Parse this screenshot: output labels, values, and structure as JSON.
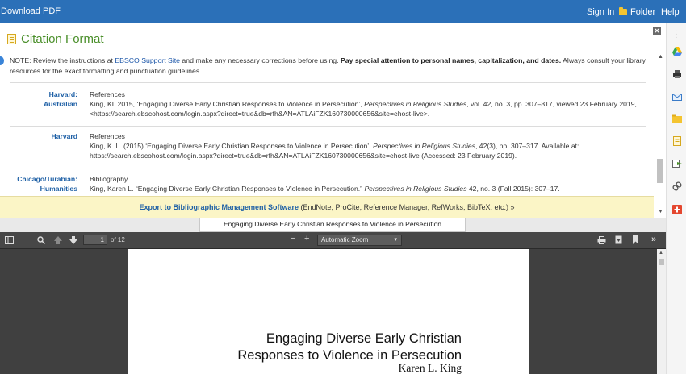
{
  "topbar": {
    "download": "Download PDF",
    "signin": "Sign In",
    "folder": "Folder",
    "help": "Help"
  },
  "citation": {
    "title": "Citation Format",
    "close": "✕",
    "note_prefix": "NOTE: Review the instructions at ",
    "note_link": "EBSCO Support Site",
    "note_mid": " and make any necessary corrections before using. ",
    "note_bold": "Pay special attention to personal names, capitalization, and dates.",
    "note_suffix": " Always consult your library resources for the exact formatting and punctuation guidelines.",
    "entries": [
      {
        "label_1": "Harvard:",
        "label_2": "Australian",
        "heading": "References",
        "line_a": "King, KL 2015, ‘Engaging Diverse Early Christian Responses to Violence in Persecution’, ",
        "journal": "Perspectives in Religious Studies",
        "line_b": ", vol. 42, no. 3, pp. 307–317, viewed 23 February 2019, <https://search.ebscohost.com/login.aspx?direct=true&db=rfh&AN=ATLAiFZK160730000656&site=ehost-live>."
      },
      {
        "label_1": "Harvard",
        "label_2": "",
        "heading": "References",
        "line_a": "King, K. L. (2015) ‘Engaging Diverse Early Christian Responses to Violence in Persecution’, ",
        "journal": "Perspectives in Religious Studies",
        "line_b": ", 42(3), pp. 307–317. Available at: https://search.ebscohost.com/login.aspx?direct=true&db=rfh&AN=ATLAiFZK160730000656&site=ehost-live (Accessed: 23 February 2019)."
      },
      {
        "label_1": "Chicago/Turabian:",
        "label_2": "Humanities",
        "heading": "Bibliography",
        "line_a": "King, Karen L. “Engaging Diverse Early Christian Responses to Violence in Persecution.” ",
        "journal": "Perspectives in Religious Studies",
        "line_b": " 42, no. 3 (Fall 2015): 307–17."
      }
    ],
    "export_link": "Export to Bibliographic Management Software",
    "export_suffix": " (EndNote, ProCite, Reference Manager, RefWorks, BibTeX, etc.) »"
  },
  "pdf": {
    "tab_title": "Engaging Diverse Early Christian Responses to Violence in Persecution",
    "page_number": "1",
    "page_count": "of 12",
    "zoom": "Automatic Zoom",
    "doc_title_1": "Engaging Diverse Early Christian",
    "doc_title_2": "Responses to Violence in Persecution",
    "doc_author": "Karen L. King"
  }
}
